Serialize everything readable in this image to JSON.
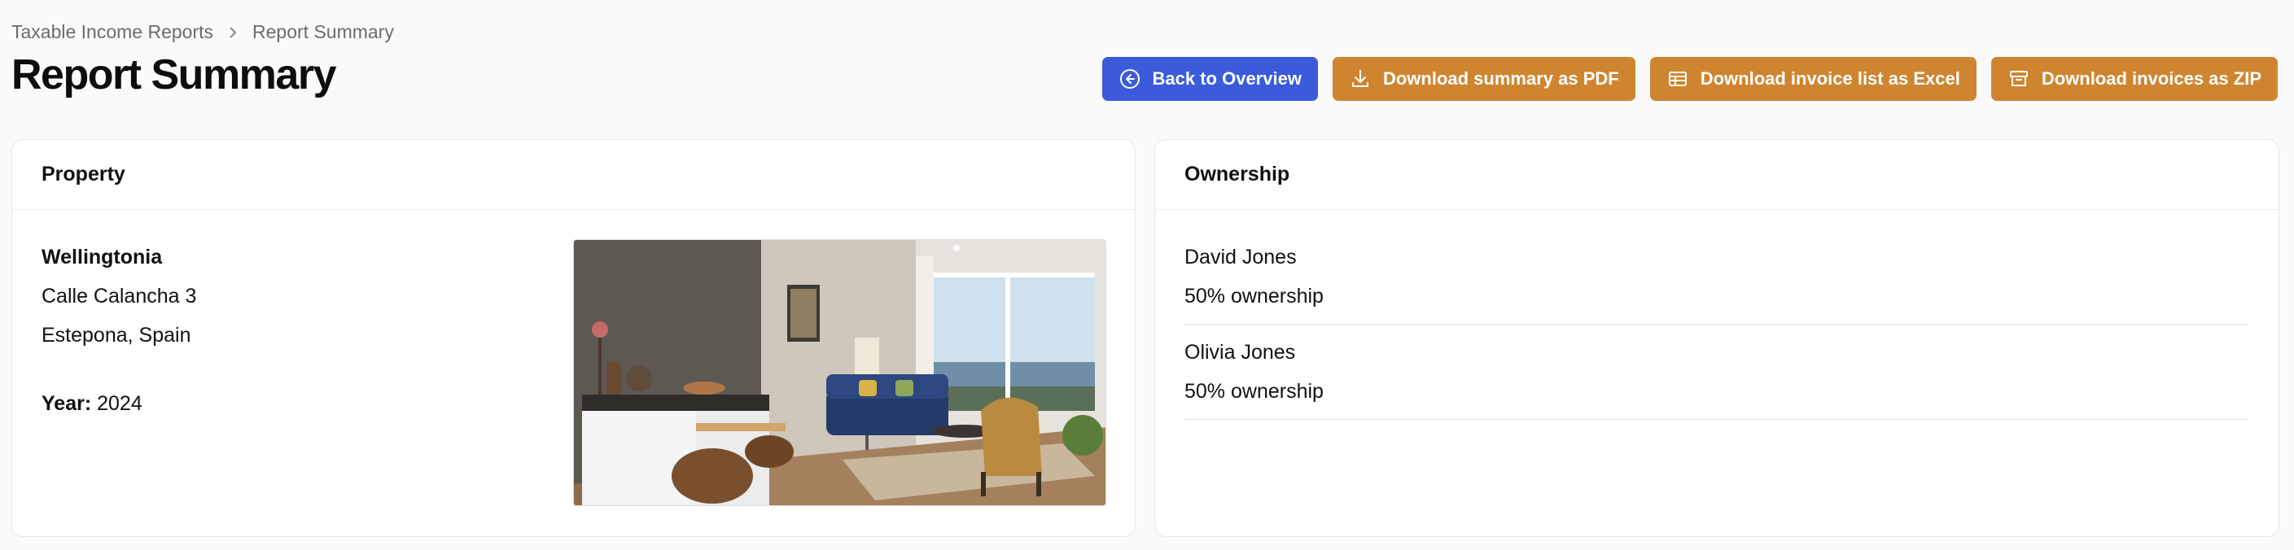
{
  "breadcrumb": {
    "items": [
      "Taxable Income Reports",
      "Report Summary"
    ]
  },
  "header": {
    "title": "Report Summary"
  },
  "actions": {
    "back_label": "Back to Overview",
    "pdf_label": "Download summary as PDF",
    "excel_label": "Download invoice list as Excel",
    "zip_label": "Download invoices as ZIP"
  },
  "property": {
    "heading": "Property",
    "name": "Wellingtonia",
    "street": "Calle Calancha 3",
    "city": "Estepona, Spain",
    "year_label": "Year:",
    "year": "2024"
  },
  "ownership": {
    "heading": "Ownership",
    "owners": [
      {
        "name": "David Jones",
        "share": "50% ownership"
      },
      {
        "name": "Olivia Jones",
        "share": "50% ownership"
      }
    ]
  },
  "colors": {
    "primary": "#3b5bdb",
    "orange": "#cf8530",
    "background": "#fafafa"
  },
  "icons": {
    "back": "circle-arrow-left-icon",
    "pdf": "download-icon",
    "excel": "table-icon",
    "zip": "archive-box-icon",
    "breadcrumb_sep": "chevron-right-icon"
  }
}
